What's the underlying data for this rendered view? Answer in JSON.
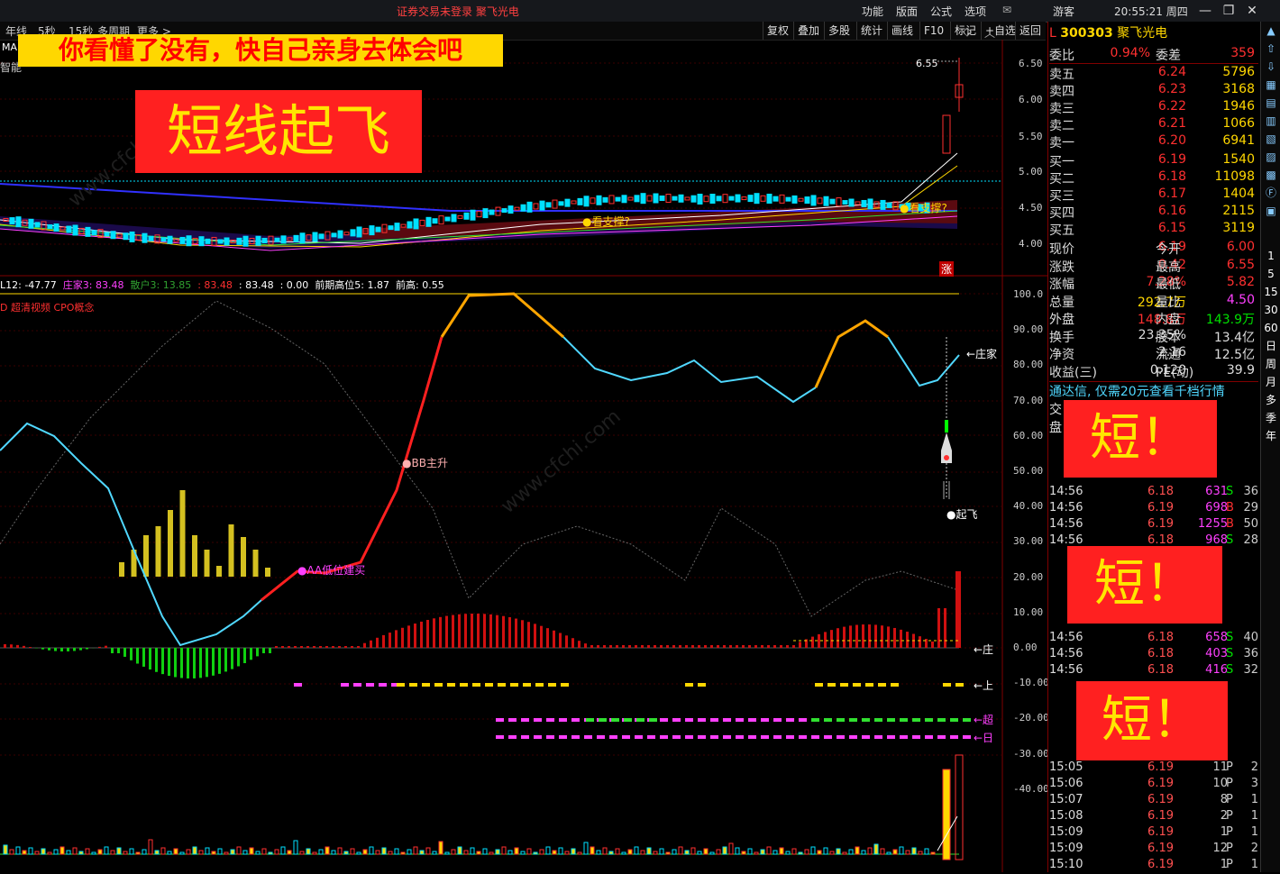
{
  "app": {
    "title": "证券交易未登录  聚飞光电",
    "menu": [
      "功能",
      "版面",
      "公式",
      "选项"
    ],
    "user": "游客",
    "clock": "20:55:21 周四"
  },
  "period_tabs": [
    "年线",
    "5秒",
    "15秒",
    "多周期",
    "更多 >"
  ],
  "toolbar": [
    "复权",
    "叠加",
    "多股",
    "统计",
    "画线",
    "F10",
    "标记",
    "+自选",
    "返回"
  ],
  "banner_text": "你看懂了没有，快自己亲身去体会吧",
  "overlay_title": "短线起飞",
  "short_label": "短！",
  "main_chart": {
    "legend_top": "MA",
    "legend_left2": "智能",
    "price_axis": [
      "6.50",
      "6.00",
      "5.50",
      "5.00",
      "4.50",
      "4.00"
    ],
    "high_label": "6.55",
    "support_label_1": "看支撑?",
    "support_label_2": "看支撑?",
    "zhang_label": "涨"
  },
  "indicator": {
    "header": "L12: -47.77  庄家3: 83.48  散户3: 13.85 : 83.48 : 83.48 : 0.00  前期高位5: 1.87  前高: 0.55",
    "header_parts": {
      "l12": "L12: -47.77",
      "zj": "庄家3: 83.48",
      "sh": "散户3: 13.85",
      "a": ": 83.48",
      "b": ": 83.48",
      "c": ": 0.00",
      "qq": "前期高位5: 1.87",
      "qg": "前高: 0.55"
    },
    "concept": "D 超清视频 CPO概念",
    "axis": [
      "100.0",
      "90.00",
      "80.00",
      "70.00",
      "60.00",
      "50.00",
      "40.00",
      "30.00",
      "20.00",
      "10.00",
      "0.00",
      "-10.00",
      "-20.00",
      "-30.00",
      "-40.00"
    ],
    "label_bb": "BB主升",
    "label_aa": "AA低位建买",
    "label_takeoff": "起飞",
    "right_labels": [
      "←庄家",
      "←庄",
      "←上",
      "←超",
      "←日"
    ]
  },
  "quote": {
    "code": "300303",
    "name": "聚飞光电",
    "weibi_label": "委比",
    "weibi": "0.94%",
    "weicha_label": "委差",
    "weicha": "359",
    "asks": [
      {
        "label": "卖五",
        "price": "6.24",
        "vol": "5796"
      },
      {
        "label": "卖四",
        "price": "6.23",
        "vol": "3168"
      },
      {
        "label": "卖三",
        "price": "6.22",
        "vol": "1946"
      },
      {
        "label": "卖二",
        "price": "6.21",
        "vol": "1066"
      },
      {
        "label": "卖一",
        "price": "6.20",
        "vol": "6941"
      }
    ],
    "bids": [
      {
        "label": "买一",
        "price": "6.19",
        "vol": "1540"
      },
      {
        "label": "买二",
        "price": "6.18",
        "vol": "11098"
      },
      {
        "label": "买三",
        "price": "6.17",
        "vol": "1404"
      },
      {
        "label": "买四",
        "price": "6.16",
        "vol": "2115"
      },
      {
        "label": "买五",
        "price": "6.15",
        "vol": "3119"
      }
    ],
    "stats": [
      {
        "l1": "现价",
        "v1": "6.19",
        "l2": "今开",
        "v2": "6.00"
      },
      {
        "l1": "涨跌",
        "v1": "0.42",
        "l2": "最高",
        "v2": "6.55"
      },
      {
        "l1": "涨幅",
        "v1": "7.28%",
        "l2": "最低",
        "v2": "5.82"
      },
      {
        "l1": "总量",
        "v1": "292.7万",
        "l2": "量比",
        "v2": "4.50"
      },
      {
        "l1": "外盘",
        "v1": "148.8万",
        "l2": "内盘",
        "v2": "143.9万"
      },
      {
        "l1": "换手",
        "v1": "23.35%",
        "l2": "股本",
        "v2": "13.4亿"
      },
      {
        "l1": "净资",
        "v1": "2.16",
        "l2": "流通",
        "v2": "12.5亿"
      },
      {
        "l1": "收益(三)",
        "v1": "0.120",
        "l2": "PE(动)",
        "v2": "39.9"
      }
    ],
    "promo": "通达信, 仅需20元查看千档行情",
    "ticks": [
      {
        "t": "14:56",
        "p": "6.18",
        "v": "631",
        "s": "S",
        "n": "36"
      },
      {
        "t": "14:56",
        "p": "6.19",
        "v": "698",
        "s": "B",
        "n": "29"
      },
      {
        "t": "14:56",
        "p": "6.19",
        "v": "1255",
        "s": "B",
        "n": "50"
      },
      {
        "t": "14:56",
        "p": "6.18",
        "v": "968",
        "s": "S",
        "n": "28"
      },
      {
        "t": "14:56",
        "p": "6.18",
        "v": "658",
        "s": "S",
        "n": "40"
      },
      {
        "t": "14:56",
        "p": "6.18",
        "v": "403",
        "s": "S",
        "n": "36"
      },
      {
        "t": "14:56",
        "p": "6.18",
        "v": "416",
        "s": "S",
        "n": "32"
      },
      {
        "t": "15:05",
        "p": "6.19",
        "v": "11",
        "s": "P",
        "n": "2"
      },
      {
        "t": "15:06",
        "p": "6.19",
        "v": "10",
        "s": "P",
        "n": "3"
      },
      {
        "t": "15:07",
        "p": "6.19",
        "v": "8",
        "s": "P",
        "n": "1"
      },
      {
        "t": "15:08",
        "p": "6.19",
        "v": "2",
        "s": "P",
        "n": "1"
      },
      {
        "t": "15:09",
        "p": "6.19",
        "v": "1",
        "s": "P",
        "n": "1"
      },
      {
        "t": "15:09",
        "p": "6.19",
        "v": "12",
        "s": "P",
        "n": "2"
      },
      {
        "t": "15:10",
        "p": "6.19",
        "v": "1",
        "s": "P",
        "n": "1"
      }
    ]
  },
  "sidebar": [
    "1",
    "5",
    "15",
    "30",
    "60",
    "日",
    "周",
    "月",
    "多",
    "季",
    "年"
  ],
  "colors": {
    "up": "#ff3030",
    "down": "#00e0ff",
    "accent": "#ffd700"
  }
}
